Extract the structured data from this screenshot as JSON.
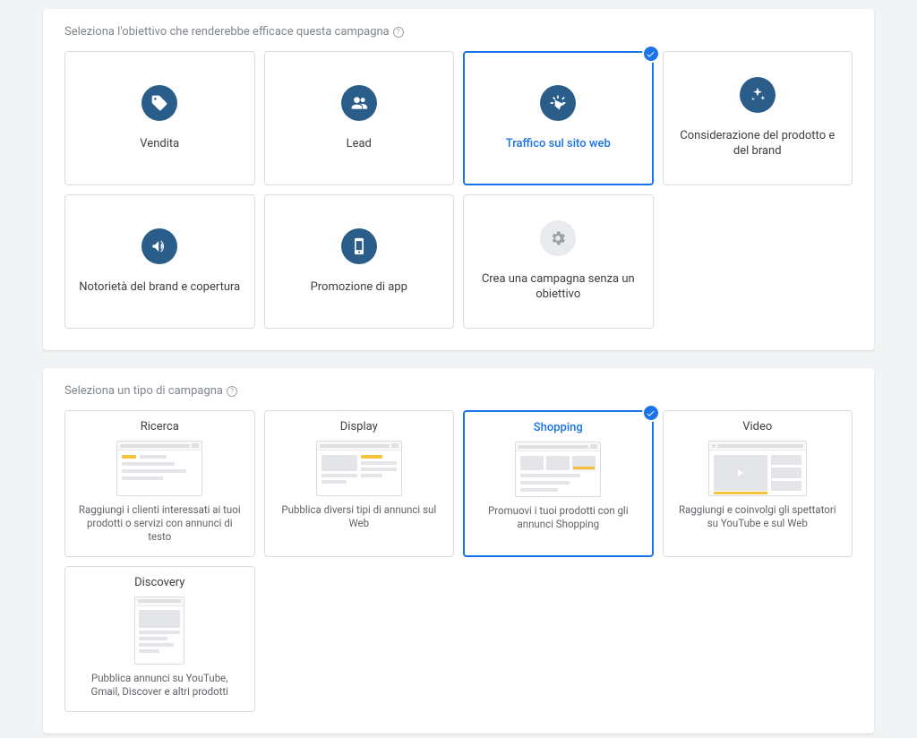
{
  "objectives": {
    "heading": "Seleziona l'obiettivo che renderebbe efficace questa campagna",
    "items": [
      {
        "id": "sales",
        "label": "Vendita",
        "icon": "tag",
        "selected": false,
        "muted": false
      },
      {
        "id": "leads",
        "label": "Lead",
        "icon": "people",
        "selected": false,
        "muted": false
      },
      {
        "id": "traffic",
        "label": "Traffico sul sito web",
        "icon": "click",
        "selected": true,
        "muted": false
      },
      {
        "id": "consideration",
        "label": "Considerazione del prodotto e del brand",
        "icon": "sparkle",
        "selected": false,
        "muted": false
      },
      {
        "id": "brand",
        "label": "Notorietà del brand e copertura",
        "icon": "mega",
        "selected": false,
        "muted": false
      },
      {
        "id": "app",
        "label": "Promozione di app",
        "icon": "phone",
        "selected": false,
        "muted": false
      },
      {
        "id": "none",
        "label": "Crea una campagna senza un obiettivo",
        "icon": "gear",
        "selected": false,
        "muted": true
      }
    ]
  },
  "campaignTypes": {
    "heading": "Seleziona un tipo di campagna",
    "items": [
      {
        "id": "search",
        "label": "Ricerca",
        "desc": "Raggiungi i clienti interessati ai tuoi prodotti o servizi con annunci di testo",
        "selected": false
      },
      {
        "id": "display",
        "label": "Display",
        "desc": "Pubblica diversi tipi di annunci sul Web",
        "selected": false
      },
      {
        "id": "shopping",
        "label": "Shopping",
        "desc": "Promuovi i tuoi prodotti con gli annunci Shopping",
        "selected": true
      },
      {
        "id": "video",
        "label": "Video",
        "desc": "Raggiungi e coinvolgi gli spettatori su YouTube e sul Web",
        "selected": false
      },
      {
        "id": "discovery",
        "label": "Discovery",
        "desc": "Pubblica annunci su YouTube, Gmail, Discover e altri prodotti",
        "selected": false
      }
    ]
  },
  "colors": {
    "accent": "#1a73e8",
    "iconBg": "#2b5d8b",
    "mutedBg": "#e8eaed",
    "yellow": "#f5c23e"
  }
}
